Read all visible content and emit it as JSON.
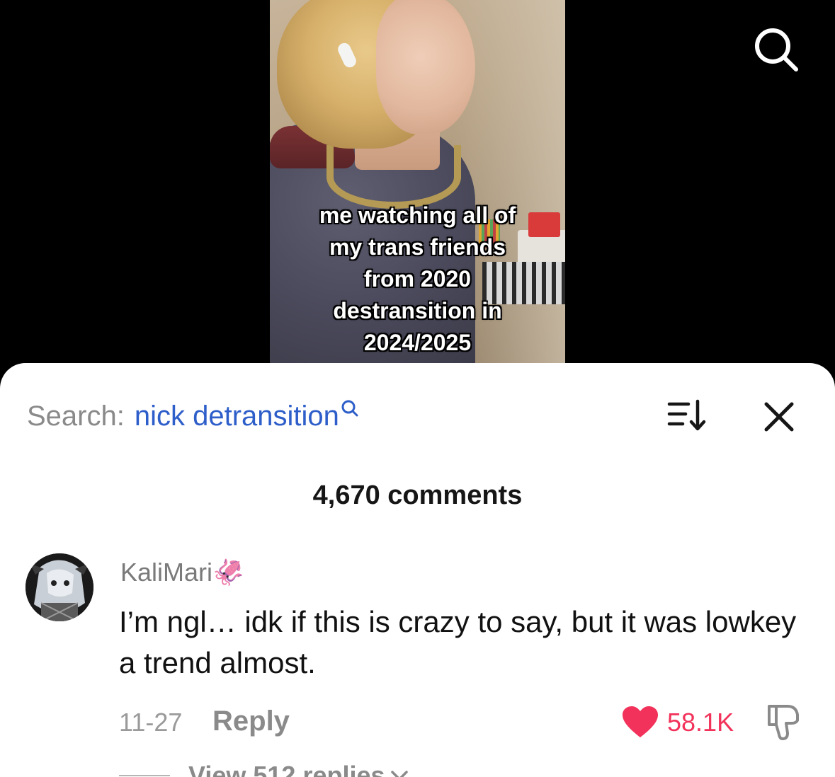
{
  "video": {
    "caption": "me watching all of\nmy trans friends\nfrom 2020\ndestransition in\n2024/2025"
  },
  "comments_panel": {
    "search_prefix": "Search:",
    "search_query": "nick detransition",
    "comment_count": "4,670 comments",
    "comments": [
      {
        "username": "KaliMari",
        "username_emoji": "🦑",
        "text": "I’m ngl… idk if this is crazy to say, but it was lowkey a trend almost.",
        "date": "11-27",
        "reply_label": "Reply",
        "likes": "58.1K",
        "view_replies": "View 512 replies"
      }
    ]
  },
  "colors": {
    "link_blue": "#2e5ec9",
    "like_red": "#f2325a",
    "muted_gray": "#8a8a8a"
  },
  "icons": [
    "search-icon",
    "sort-icon",
    "close-icon",
    "heart-icon",
    "thumbs-down-icon",
    "chevron-down-icon"
  ]
}
